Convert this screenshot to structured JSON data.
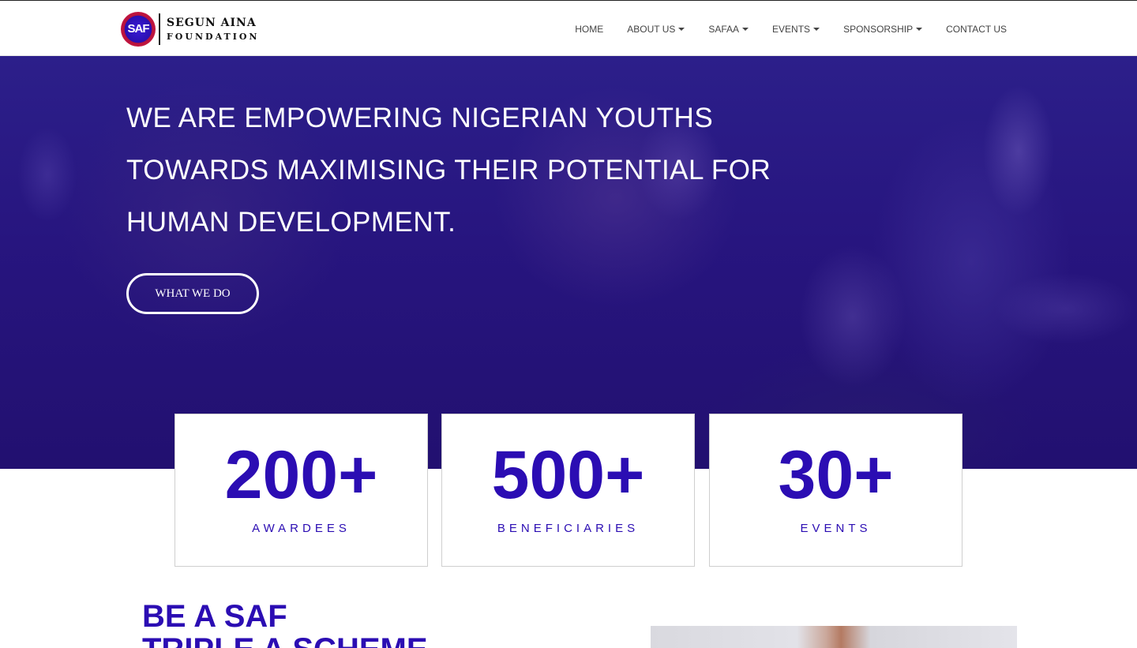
{
  "brand": {
    "badge_text": "SAF",
    "line1": "SEGUN AINA",
    "line2": "FOUNDATION"
  },
  "nav": {
    "items": [
      {
        "label": "HOME",
        "dropdown": false
      },
      {
        "label": "ABOUT US",
        "dropdown": true
      },
      {
        "label": "SAFAA",
        "dropdown": true
      },
      {
        "label": "EVENTS",
        "dropdown": true
      },
      {
        "label": "SPONSORSHIP",
        "dropdown": true
      },
      {
        "label": "CONTACT US",
        "dropdown": false
      }
    ]
  },
  "hero": {
    "title": "WE ARE EMPOWERING NIGERIAN YOUTHS TOWARDS MAXIMISING THEIR POTENTIAL FOR HUMAN DEVELOPMENT.",
    "button_label": "WHAT WE DO"
  },
  "stats": [
    {
      "number": "200+",
      "label": "AWARDEES"
    },
    {
      "number": "500+",
      "label": "BENEFICIARIES"
    },
    {
      "number": "30+",
      "label": "EVENTS"
    }
  ],
  "scheme": {
    "title_line1": "BE A SAF",
    "title_line2": "TRIPLE A SCHEME"
  },
  "colors": {
    "accent": "#2b0db3",
    "hero_overlay": "#27157f",
    "nav_text": "#444444"
  }
}
